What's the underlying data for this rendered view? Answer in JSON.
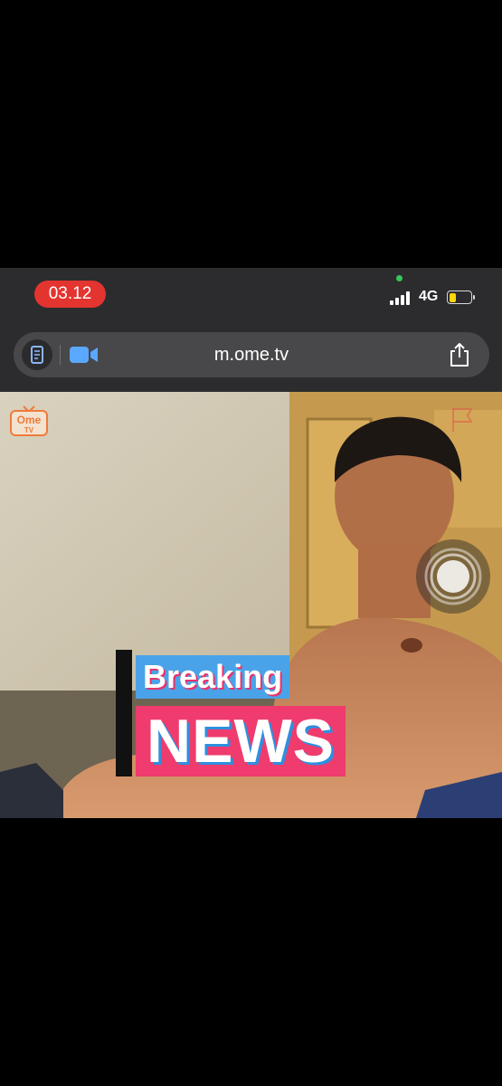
{
  "status_bar": {
    "time": "03.12",
    "network": "4G",
    "battery_level": 0.3,
    "colors": {
      "time_pill": "#e3342f",
      "battery": "#ffd60a",
      "camera_dot": "#34c759"
    }
  },
  "browser": {
    "url": "m.ome.tv",
    "icons": {
      "reader": "reader-icon",
      "camera": "video-camera-icon",
      "share": "share-icon"
    }
  },
  "video": {
    "logo_text": [
      "Ome",
      "TV"
    ],
    "overlay": {
      "line1": "Breaking",
      "line2": "NEWS"
    },
    "icons": {
      "flag": "flag-icon",
      "touch": "assistive-touch-icon"
    }
  }
}
